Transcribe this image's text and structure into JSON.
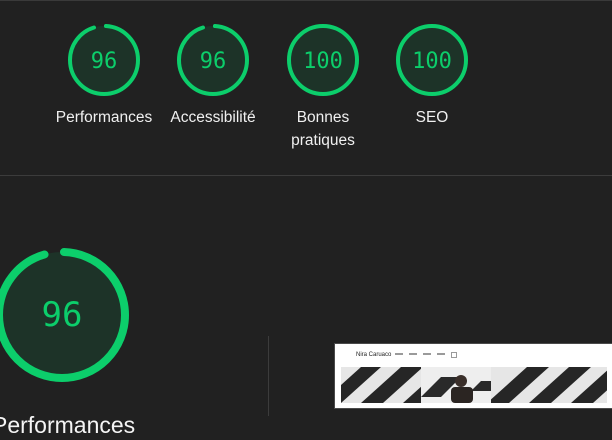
{
  "colors": {
    "background": "#212121",
    "score_green": "#0cce6b",
    "gauge_fill": "#1d3328",
    "divider": "#3c3c3c"
  },
  "summary": {
    "gauges": [
      {
        "label": "Performances",
        "score": "96",
        "fraction": 0.96
      },
      {
        "label": "Accessibilité",
        "score": "96",
        "fraction": 0.96
      },
      {
        "label_line1": "Bonnes",
        "label_line2": "pratiques",
        "score": "100",
        "fraction": 1.0
      },
      {
        "label": "SEO",
        "score": "100",
        "fraction": 1.0
      }
    ]
  },
  "performance": {
    "score": "96",
    "fraction": 0.96,
    "title": "Performances"
  },
  "screenshot_thumbnail": {
    "site_title": "Nira Caruaco"
  }
}
